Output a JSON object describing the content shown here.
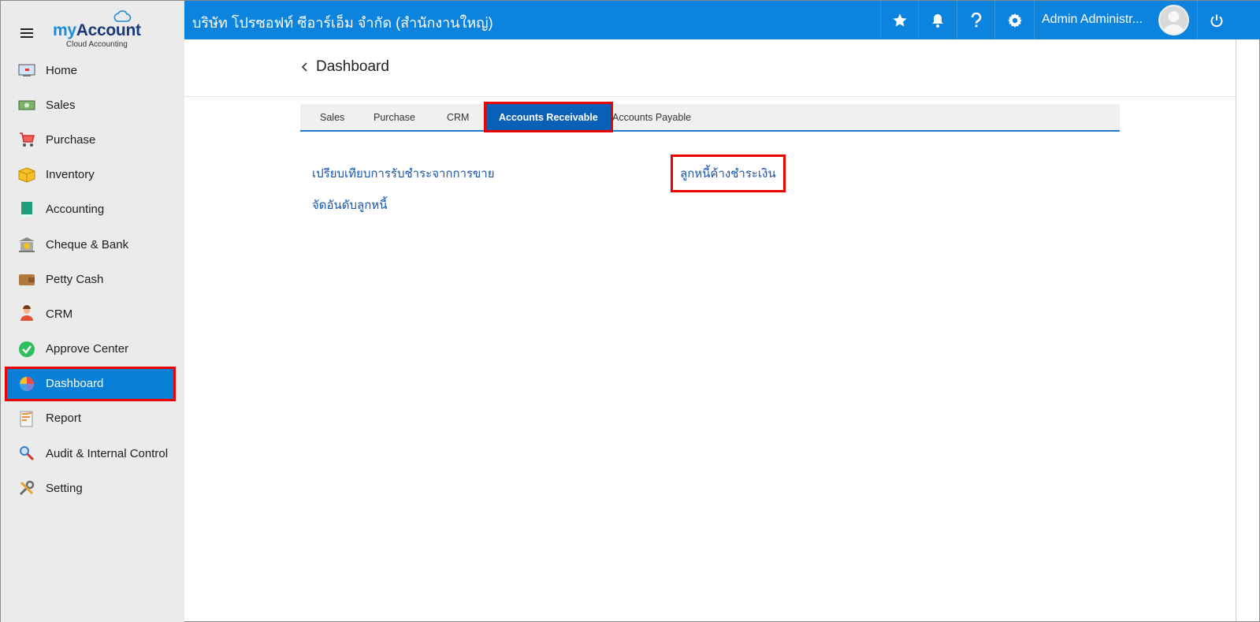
{
  "app": {
    "brand_my": "my",
    "brand_account": "Account",
    "brand_sub": "Cloud Accounting"
  },
  "header": {
    "company": "บริษัท โปรซอฟท์ ซีอาร์เอ็ม จำกัด (สำนักงานใหญ่)",
    "user": "Admin Administr...",
    "accent": "#0c83dc"
  },
  "sidebar": {
    "items": [
      {
        "label": "Home",
        "icon": "home-icon"
      },
      {
        "label": "Sales",
        "icon": "sales-icon"
      },
      {
        "label": "Purchase",
        "icon": "cart-icon"
      },
      {
        "label": "Inventory",
        "icon": "box-icon"
      },
      {
        "label": "Accounting",
        "icon": "book-icon"
      },
      {
        "label": "Cheque & Bank",
        "icon": "bank-icon"
      },
      {
        "label": "Petty Cash",
        "icon": "wallet-icon"
      },
      {
        "label": "CRM",
        "icon": "crm-icon"
      },
      {
        "label": "Approve Center",
        "icon": "check-circle-icon"
      },
      {
        "label": "Dashboard",
        "icon": "pie-chart-icon"
      },
      {
        "label": "Report",
        "icon": "report-icon"
      },
      {
        "label": "Audit & Internal Control",
        "icon": "magnifier-icon"
      },
      {
        "label": "Setting",
        "icon": "tools-icon"
      }
    ],
    "active_index": 9
  },
  "page": {
    "title": "Dashboard"
  },
  "tabs": [
    {
      "label": "Sales"
    },
    {
      "label": "Purchase"
    },
    {
      "label": "CRM"
    },
    {
      "label": "Accounts Receivable"
    },
    {
      "label": "Accounts Payable"
    }
  ],
  "reports": {
    "left": [
      "เปรียบเทียบการรับชำระจากการขาย",
      "จัดอันดับลูกหนี้"
    ],
    "right": [
      "ลูกหนี้ค้างชำระเงิน"
    ]
  }
}
